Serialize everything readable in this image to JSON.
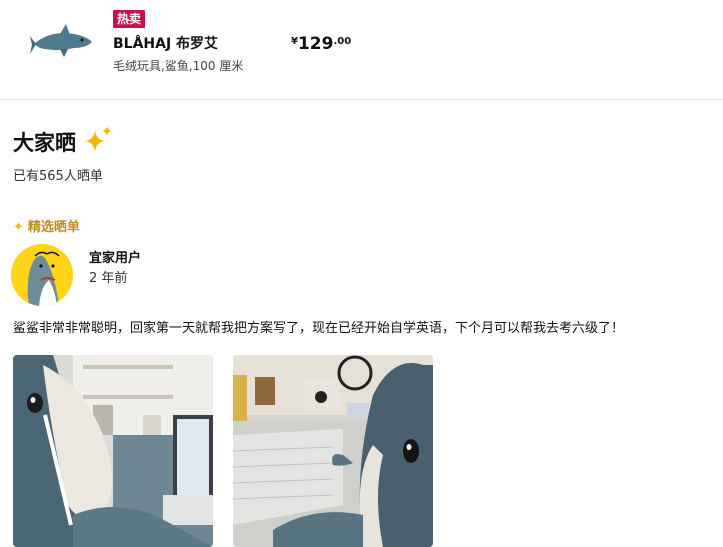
{
  "product": {
    "badge": "热卖",
    "name": "BLÅHAJ 布罗艾",
    "description": "毛绒玩具,鲨鱼,100 厘米",
    "price": {
      "currency": "¥",
      "integer": "129",
      "decimal": ".00"
    }
  },
  "reviews_section": {
    "title": "大家晒",
    "count_text": "已有565人晒单",
    "featured_label": "精选晒单"
  },
  "review": {
    "user_name": "宜家用户",
    "time": "2 年前",
    "text": "鲨鲨非常非常聪明，回家第一天就帮我把方案写了，现在已经开始自学英语，下个月可以帮我去考六级了！"
  },
  "icons": {
    "sparkle": "sparkle-icon",
    "featured_star": "star-icon"
  },
  "colors": {
    "badge": "#cc0f4f",
    "featured": "#c58b1c",
    "sparkle": "#f5b400",
    "avatar_bg": "#ffd51a"
  }
}
